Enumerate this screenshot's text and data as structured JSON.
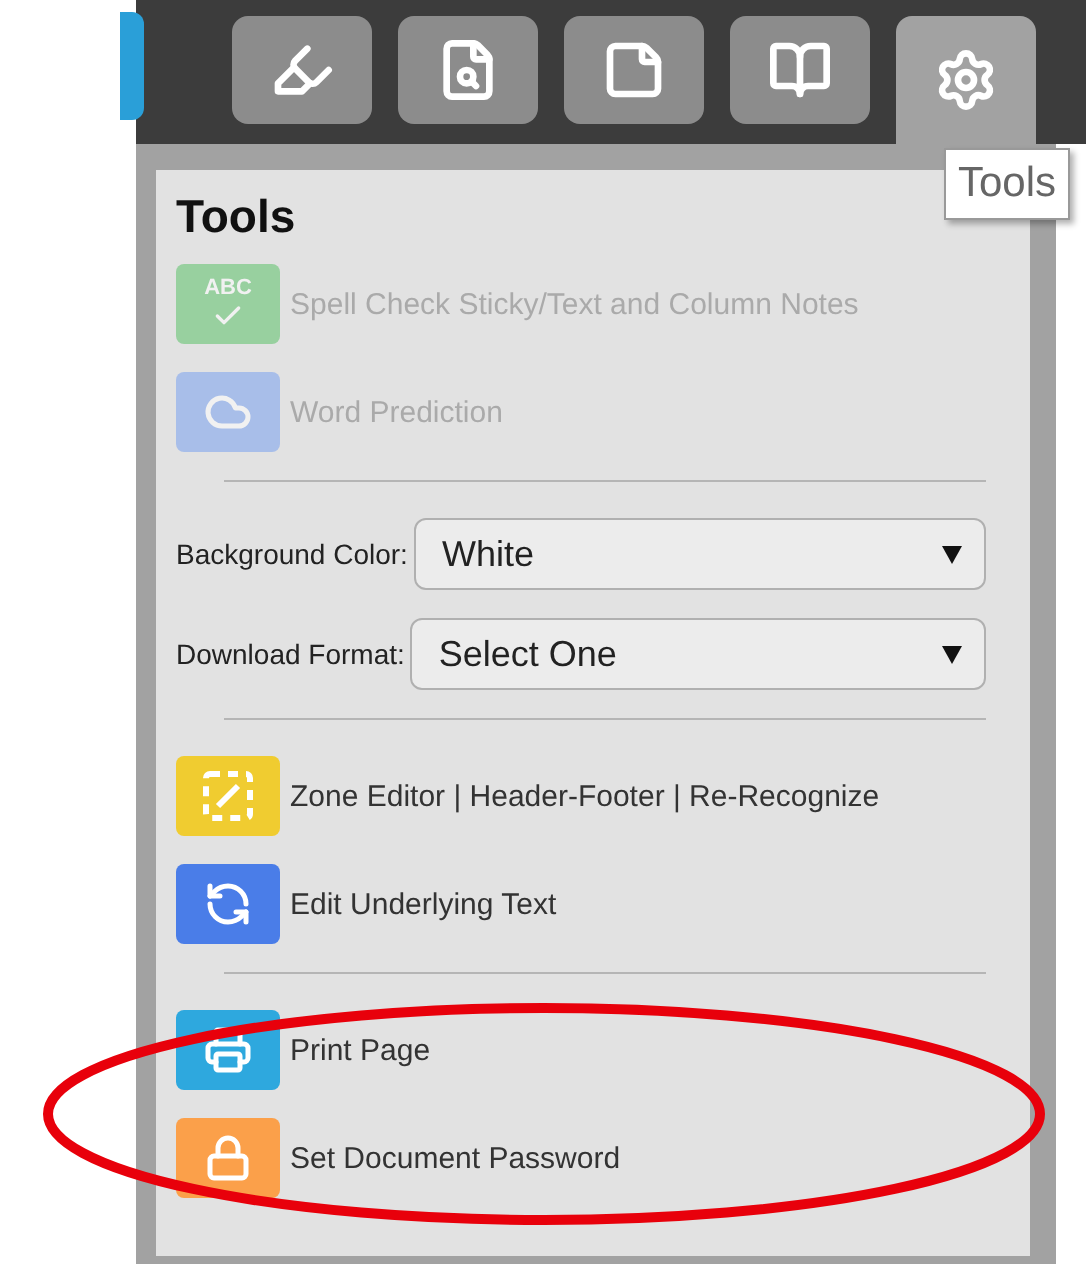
{
  "tabs": [
    {
      "kind": "highlighter",
      "selected": false
    },
    {
      "kind": "doc-search",
      "selected": false
    },
    {
      "kind": "sticky-note",
      "selected": false
    },
    {
      "kind": "book",
      "selected": false
    },
    {
      "kind": "tools",
      "selected": true
    }
  ],
  "tooltip": "Tools",
  "title": "Tools",
  "groups": [
    {
      "kind": "actions",
      "items": [
        {
          "kind": "spell",
          "badge": "ABC",
          "label": "Spell Check Sticky/Text and Column Notes",
          "disabled": true
        },
        {
          "kind": "cloud",
          "label": "Word Prediction",
          "disabled": true
        }
      ]
    },
    {
      "kind": "selects",
      "items": [
        {
          "label": "Background Color:",
          "value": "White"
        },
        {
          "label": "Download Format:",
          "value": "Select One"
        }
      ]
    },
    {
      "kind": "actions",
      "items": [
        {
          "kind": "zone",
          "label": "Zone Editor | Header-Footer | Re-Recognize",
          "disabled": false
        },
        {
          "kind": "sync",
          "label": "Edit Underlying Text",
          "disabled": false
        }
      ]
    },
    {
      "kind": "actions",
      "items": [
        {
          "kind": "print",
          "label": "Print Page",
          "disabled": false
        },
        {
          "kind": "lock",
          "label": "Set Document Password",
          "disabled": false
        }
      ]
    }
  ]
}
